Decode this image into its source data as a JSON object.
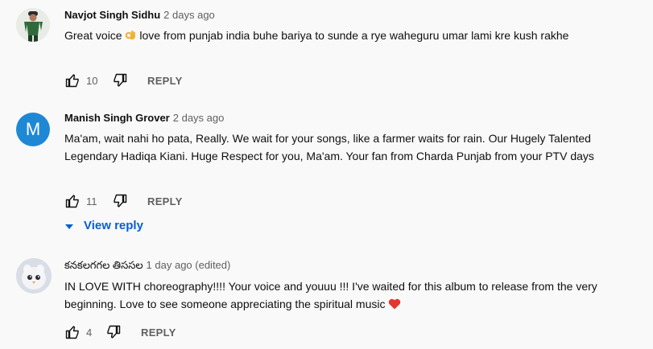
{
  "comments": [
    {
      "author": "Navjot Singh Sidhu",
      "time": "2 days ago",
      "text_before_emoji": "Great voice ",
      "emoji": "ok-hand-emoji",
      "text_after_emoji": "  love from punjab india  buhe bariya to sunde a rye waheguru umar lami kre kush rakhe",
      "likes": "10",
      "reply_label": "REPLY"
    },
    {
      "author": "Manish Singh Grover",
      "time": "2 days ago",
      "avatar_letter": "M",
      "avatar_color": "#1e88d5",
      "text": "Ma'am, wait nahi ho pata,  Really. We wait for your songs, like a farmer waits for rain. Our Hugely Talented Legendary Hadiqa Kiani. Huge Respect for you,  Ma'am. Your fan from Charda Punjab from your PTV days",
      "likes": "11",
      "reply_label": "REPLY",
      "view_reply_label": "View reply"
    },
    {
      "author": "కనకలగగల తిససల",
      "time": "1 day ago (edited)",
      "text": "IN LOVE WITH choreography!!!! Your voice and youuu !!! I've waited for this album to release from the very beginning. Love to see someone appreciating the spiritual music ",
      "emoji": "red-heart-emoji",
      "likes": "4",
      "reply_label": "REPLY"
    }
  ],
  "colors": {
    "background": "#f9f9f9",
    "link_blue": "#065fd4",
    "secondary_text": "#606060"
  }
}
